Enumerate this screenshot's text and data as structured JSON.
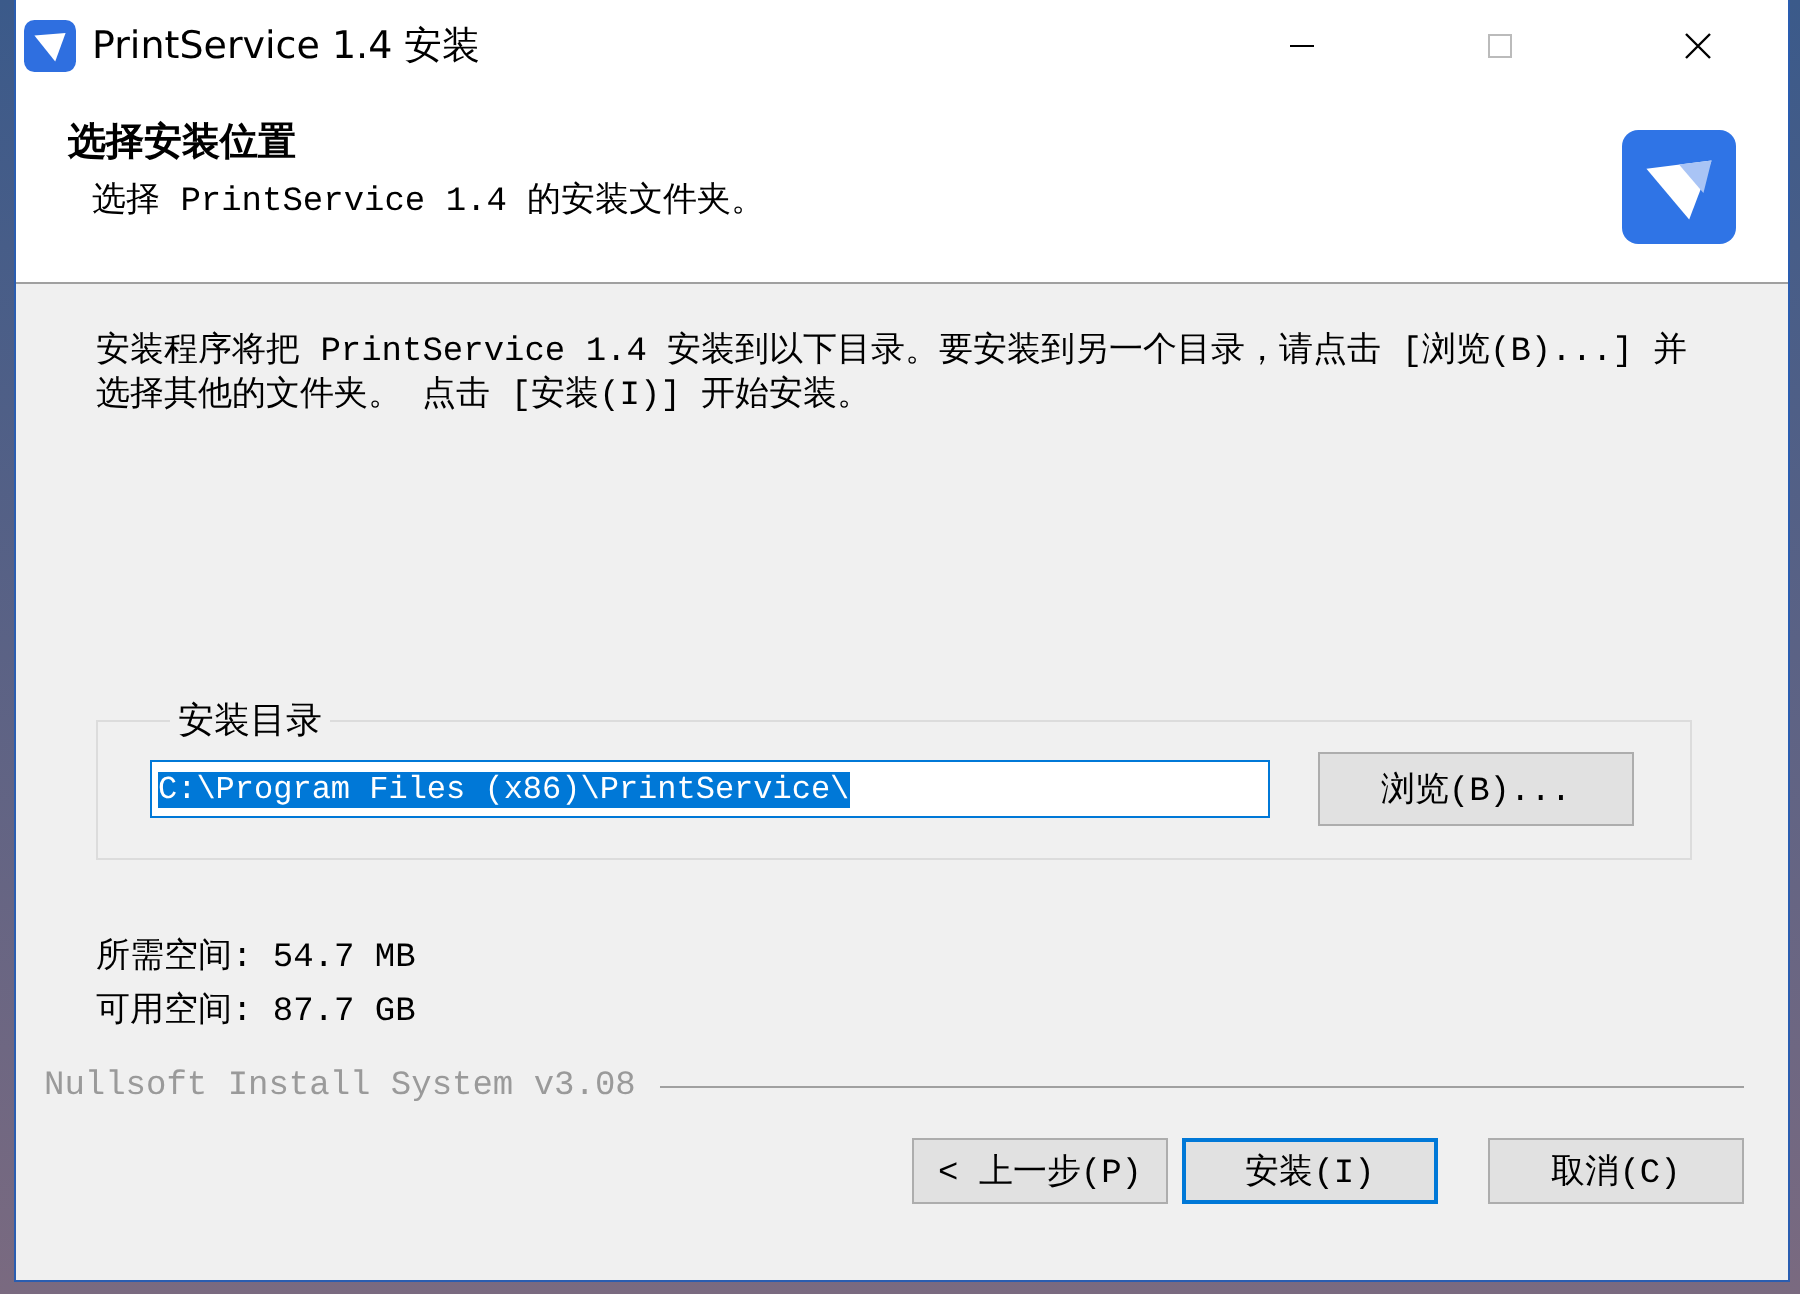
{
  "window": {
    "title": "PrintService 1.4 安装"
  },
  "header": {
    "title": "选择安装位置",
    "subtitle": "选择 PrintService 1.4 的安装文件夹。"
  },
  "description": "安装程序将把 PrintService 1.4 安装到以下目录。要安装到另一个目录，请点击 [浏览(B)...] 并选择其他的文件夹。 点击 [安装(I)] 开始安装。",
  "directory_group": {
    "label": "安装目录",
    "path": "C:\\Program Files (x86)\\PrintService\\",
    "browse_button": "浏览(B)..."
  },
  "space": [
    "所需空间: 54.7 MB",
    "可用空间: 87.7 GB"
  ],
  "branding": "Nullsoft Install System v3.08",
  "buttons": [
    {
      "label": "< 上一步(P)",
      "default": false
    },
    {
      "label": "安装(I)",
      "default": true
    },
    {
      "label": "取消(C)",
      "default": false
    }
  ]
}
